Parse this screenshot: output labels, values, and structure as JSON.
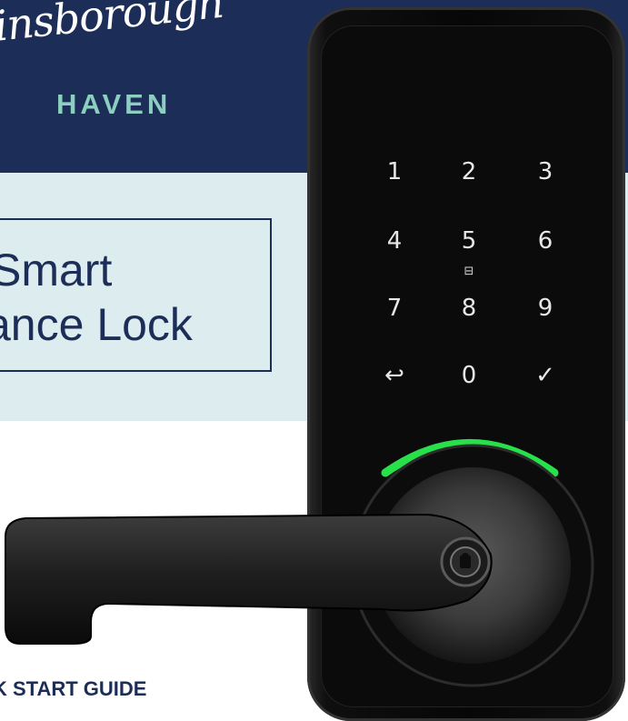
{
  "brand": {
    "script_name": "insborough",
    "sub_name": "HAVEN"
  },
  "title": {
    "line1": "Smart",
    "line2": "ance Lock"
  },
  "footer": {
    "guide_label": "K START GUIDE"
  },
  "keypad": {
    "keys": [
      "1",
      "2",
      "3",
      "4",
      "5",
      "6",
      "7",
      "8",
      "9",
      "↩",
      "0",
      "✓"
    ],
    "lock_glyph": "⊟"
  },
  "colors": {
    "navy": "#1c2e57",
    "band": "#dcecef",
    "teal": "#8ccfc0",
    "indicator_green": "#27e04a"
  }
}
